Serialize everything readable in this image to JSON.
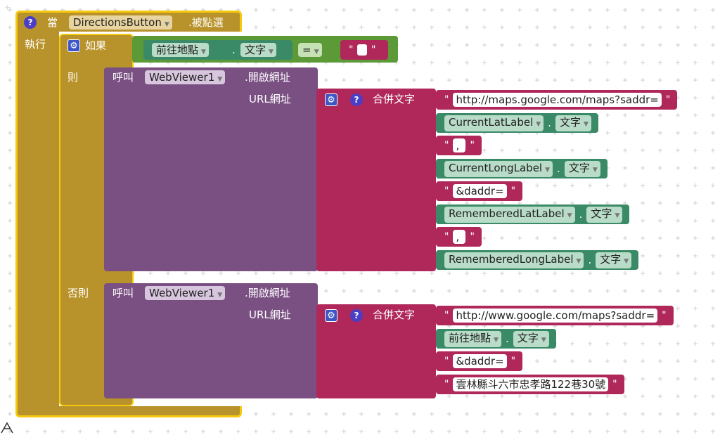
{
  "event": {
    "when_label": "當",
    "component": "DirectionsButton",
    "event_name": ".被點選",
    "do_label": "執行"
  },
  "if_block": {
    "if_label": "如果",
    "then_label": "則",
    "else_label": "否則",
    "condition": {
      "component": "前往地點",
      "property": "文字",
      "operator": "="
    }
  },
  "then_call": {
    "call_label": "呼叫",
    "component": "WebViewer1",
    "method": ".開啟網址",
    "arg_label": "URL網址",
    "join_label": "合併文字",
    "items": [
      {
        "kind": "text",
        "value": "http://maps.google.com/maps?saddr="
      },
      {
        "kind": "getter",
        "component": "CurrentLatLabel",
        "property": "文字"
      },
      {
        "kind": "text",
        "value": ","
      },
      {
        "kind": "getter",
        "component": "CurrentLongLabel",
        "property": "文字"
      },
      {
        "kind": "text",
        "value": "&daddr="
      },
      {
        "kind": "getter",
        "component": "RememberedLatLabel",
        "property": "文字"
      },
      {
        "kind": "text",
        "value": ","
      },
      {
        "kind": "getter",
        "component": "RememberedLongLabel",
        "property": "文字"
      }
    ]
  },
  "else_call": {
    "call_label": "呼叫",
    "component": "WebViewer1",
    "method": ".開啟網址",
    "arg_label": "URL網址",
    "join_label": "合併文字",
    "items": [
      {
        "kind": "text",
        "value": "http://www.google.com/maps?saddr="
      },
      {
        "kind": "getter",
        "component": "前往地點",
        "property": "文字"
      },
      {
        "kind": "text",
        "value": "&daddr="
      },
      {
        "kind": "text",
        "value": "雲林縣斗六市忠孝路122巷30號"
      }
    ]
  },
  "symbols": {
    "quote": "\"",
    "dot": ".",
    "help": "?",
    "gear": "⚙"
  },
  "colors": {
    "event": "#b8922a",
    "control": "#b8922a",
    "procedure": "#7a5083",
    "text": "#b0285a",
    "logic": "#5b9a37",
    "component": "#3a8a68"
  }
}
